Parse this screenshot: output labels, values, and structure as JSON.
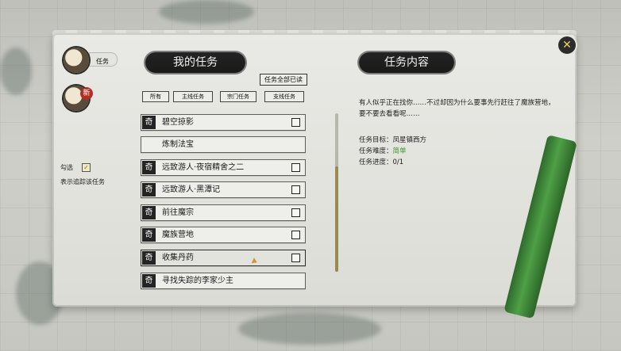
{
  "tabs": {
    "quests_label": "任务",
    "new_badge": "新"
  },
  "sidebar": {
    "filter_label": "勾选",
    "filter_mark": "✓",
    "filter_desc": "表示追踪该任务"
  },
  "my_quests": {
    "title": "我的任务",
    "mark_all_read": "任务全部已读",
    "filters": [
      "所有",
      "主线任务",
      "宗门任务",
      "支线任务"
    ],
    "items": [
      {
        "icon": "奇",
        "name": "碧空掠影",
        "tracked": false,
        "has_checkbox": true
      },
      {
        "icon": "",
        "name": "炼制法宝",
        "tracked": false,
        "has_checkbox": false
      },
      {
        "icon": "奇",
        "name": "远致游人·夜宿精舍之二",
        "tracked": false,
        "has_checkbox": true
      },
      {
        "icon": "奇",
        "name": "远致游人·黑潭记",
        "tracked": false,
        "has_checkbox": true
      },
      {
        "icon": "奇",
        "name": "前往魔宗",
        "tracked": false,
        "has_checkbox": true
      },
      {
        "icon": "奇",
        "name": "魔族营地",
        "tracked": false,
        "has_checkbox": true
      },
      {
        "icon": "奇",
        "name": "收集丹药",
        "tracked": false,
        "has_checkbox": true
      },
      {
        "icon": "奇",
        "name": "寻找失踪的李家少主",
        "tracked": false,
        "has_checkbox": false
      }
    ]
  },
  "quest_detail": {
    "title": "任务内容",
    "description": "有人似乎正在找你……不过却因为什么要事先行赶往了魔族营地，要不要去看看呢……",
    "goal_label": "任务目标：",
    "goal": "凤星镇西方",
    "difficulty_label": "任务难度：",
    "difficulty": "简单",
    "difficulty_color": "#3d9a2a",
    "progress_label": "任务进度：",
    "progress": "0/1"
  },
  "close_icon": "close-icon"
}
